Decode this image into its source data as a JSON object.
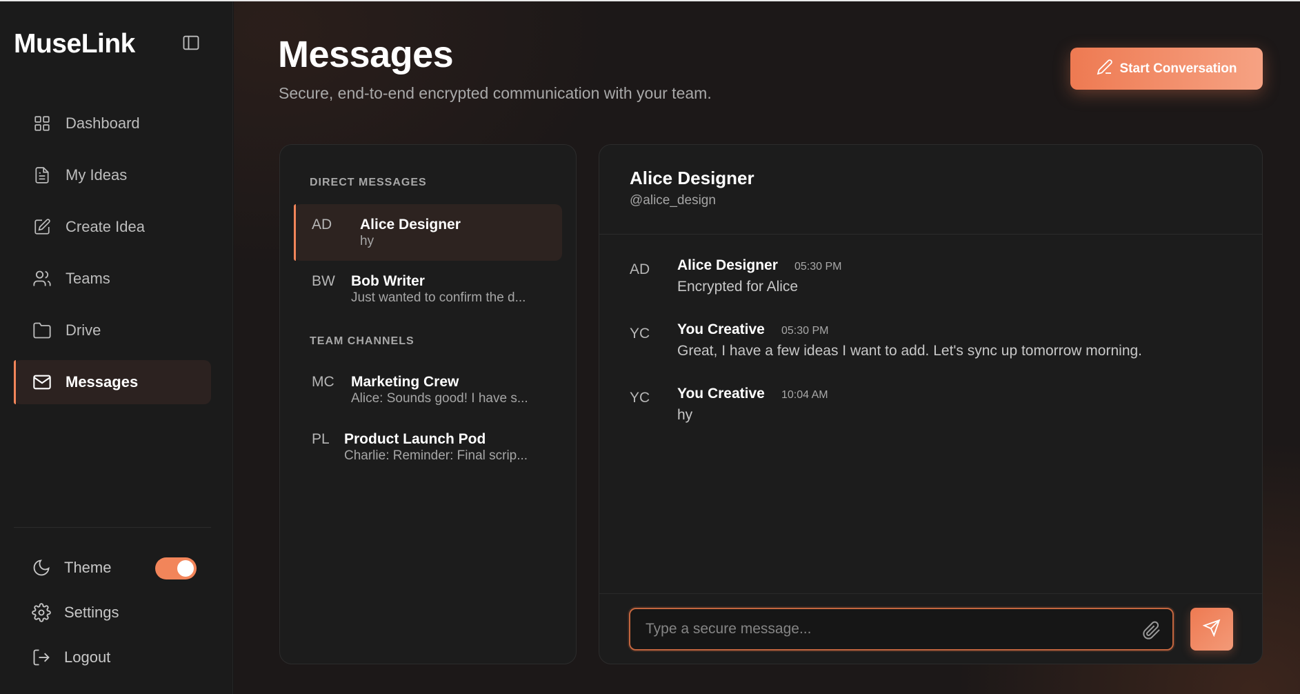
{
  "app": {
    "brand": "MuseLink"
  },
  "sidebar": {
    "items": [
      {
        "label": "Dashboard",
        "icon": "grid-icon",
        "active": false
      },
      {
        "label": "My Ideas",
        "icon": "document-icon",
        "active": false
      },
      {
        "label": "Create Idea",
        "icon": "pencil-square-icon",
        "active": false
      },
      {
        "label": "Teams",
        "icon": "users-icon",
        "active": false
      },
      {
        "label": "Drive",
        "icon": "folder-icon",
        "active": false
      },
      {
        "label": "Messages",
        "icon": "mail-icon",
        "active": true
      }
    ],
    "bottom": {
      "theme_label": "Theme",
      "theme_enabled": true,
      "settings_label": "Settings",
      "logout_label": "Logout"
    }
  },
  "header": {
    "title": "Messages",
    "subtitle": "Secure, end-to-end encrypted communication with your team.",
    "start_button": "Start Conversation"
  },
  "conversations": {
    "direct_label": "DIRECT MESSAGES",
    "direct": [
      {
        "initials": "AD",
        "name": "Alice Designer",
        "preview": "hy",
        "active": true
      },
      {
        "initials": "BW",
        "name": "Bob Writer",
        "preview": "Just wanted to confirm the d...",
        "active": false
      }
    ],
    "teams_label": "TEAM CHANNELS",
    "teams": [
      {
        "initials": "MC",
        "name": "Marketing Crew",
        "preview": "Alice: Sounds good! I have s..."
      },
      {
        "initials": "PL",
        "name": "Product Launch Pod",
        "preview": "Charlie: Reminder: Final scrip..."
      }
    ]
  },
  "chat": {
    "name": "Alice Designer",
    "handle": "@alice_design",
    "messages": [
      {
        "initials": "AD",
        "sender": "Alice Designer",
        "time": "05:30 PM",
        "text": "Encrypted for Alice"
      },
      {
        "initials": "YC",
        "sender": "You Creative",
        "time": "05:30 PM",
        "text": "Great, I have a few ideas I want to add. Let's sync up tomorrow morning."
      },
      {
        "initials": "YC",
        "sender": "You Creative",
        "time": "10:04 AM",
        "text": "hy"
      }
    ],
    "input_placeholder": "Type a secure message...",
    "input_value": ""
  },
  "colors": {
    "accent": "#f2855a",
    "accent_light": "#f6a283",
    "background": "#171717",
    "panel": "#1c1c1c",
    "active_bg": "#2c2220"
  }
}
